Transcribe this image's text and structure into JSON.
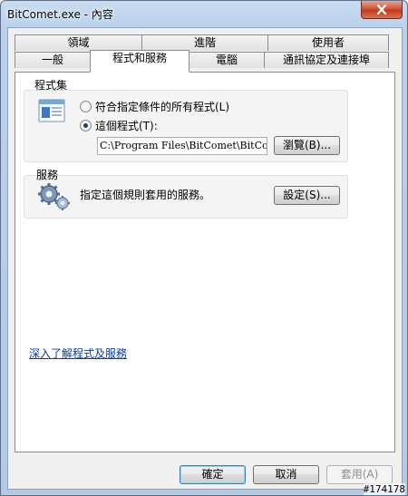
{
  "window": {
    "title": "BitComet.exe - 內容",
    "close_icon": "close-icon",
    "colors": {
      "frame": "#b9d1ec",
      "close": "#c23a1f",
      "link": "#0a3aa8"
    }
  },
  "tabs": {
    "row_top": [
      "領域",
      "進階",
      "使用者"
    ],
    "row_bottom": [
      "一般",
      "程式和服務",
      "電腦",
      "通訊協定及連接埠"
    ],
    "active": "程式和服務"
  },
  "programs": {
    "label": "程式集",
    "icon": "program-window-icon",
    "option_all": "符合指定條件的所有程式(L)",
    "option_this": "這個程式(T):",
    "selected": "這個程式(T):",
    "path": "C:\\Program Files\\BitComet\\BitComet.e",
    "browse_button": "瀏覽(B)..."
  },
  "services": {
    "label": "服務",
    "icon": "services-gears-icon",
    "description": "指定這個規則套用的服務。",
    "settings_button": "設定(S)..."
  },
  "learn_more_link": "深入了解程式及服務",
  "footer": {
    "ok_button": "確定",
    "cancel_button": "取消",
    "apply_button": "套用(A)"
  },
  "watermark": "#174178"
}
